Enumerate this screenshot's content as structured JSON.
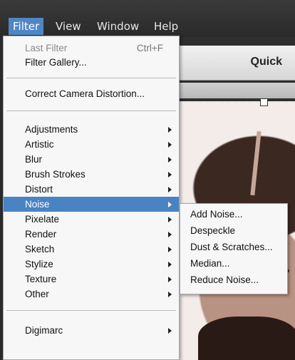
{
  "menubar": {
    "items": [
      {
        "label": "Filter"
      },
      {
        "label": "View"
      },
      {
        "label": "Window"
      },
      {
        "label": "Help"
      }
    ]
  },
  "app": {
    "panel_title": "Quick"
  },
  "filter_menu": {
    "last_filter": {
      "label": "Last Filter",
      "shortcut": "Ctrl+F"
    },
    "filter_gallery": "Filter Gallery...",
    "correct_camera_distortion": "Correct Camera Distortion...",
    "items": [
      {
        "label": "Adjustments"
      },
      {
        "label": "Artistic"
      },
      {
        "label": "Blur"
      },
      {
        "label": "Brush Strokes"
      },
      {
        "label": "Distort"
      },
      {
        "label": "Noise"
      },
      {
        "label": "Pixelate"
      },
      {
        "label": "Render"
      },
      {
        "label": "Sketch"
      },
      {
        "label": "Stylize"
      },
      {
        "label": "Texture"
      },
      {
        "label": "Other"
      }
    ],
    "digimarc": "Digimarc"
  },
  "noise_submenu": {
    "items": [
      {
        "label": "Add Noise..."
      },
      {
        "label": "Despeckle"
      },
      {
        "label": "Dust & Scratches..."
      },
      {
        "label": "Median..."
      },
      {
        "label": "Reduce Noise..."
      }
    ]
  },
  "colors": {
    "highlight": "#4a83c4",
    "menu_bg": "#f7f7f7",
    "menubar_bg": "#2d2d2d"
  }
}
